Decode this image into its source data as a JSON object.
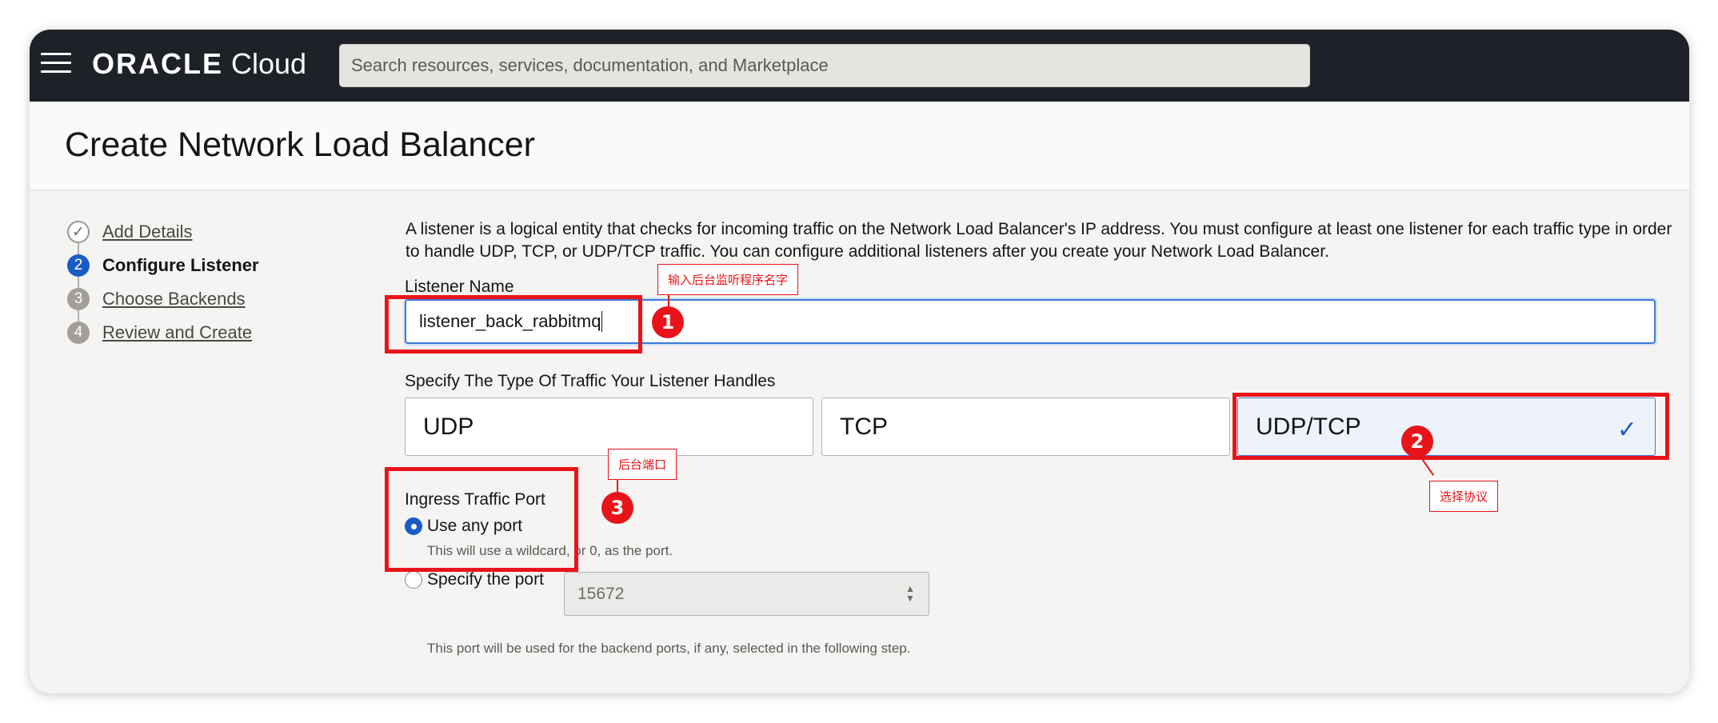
{
  "topbar": {
    "brand_oracle": "ORACLE",
    "brand_cloud": "Cloud",
    "search_placeholder": "Search resources, services, documentation, and Marketplace"
  },
  "page": {
    "title": "Create Network Load Balancer"
  },
  "steps": [
    {
      "number": "✓",
      "label": "Add Details",
      "state": "done"
    },
    {
      "number": "2",
      "label": "Configure Listener",
      "state": "active"
    },
    {
      "number": "3",
      "label": "Choose Backends",
      "state": "todo"
    },
    {
      "number": "4",
      "label": "Review and Create",
      "state": "todo"
    }
  ],
  "intro": "A listener is a logical entity that checks for incoming traffic on the Network Load Balancer's IP address. You must configure at least one listener for each traffic type in order to handle UDP, TCP, or UDP/TCP traffic. You can configure additional listeners after you create your Network Load Balancer.",
  "listener_name": {
    "label": "Listener Name",
    "value": "listener_back_rabbitmq"
  },
  "traffic": {
    "label": "Specify The Type Of Traffic Your Listener Handles",
    "options": [
      "UDP",
      "TCP",
      "UDP/TCP"
    ],
    "selected": "UDP/TCP"
  },
  "ingress": {
    "label": "Ingress Traffic Port",
    "any_port_label": "Use any port",
    "any_port_hint": "This will use a wildcard, or 0, as the port.",
    "specify_label": "Specify the port",
    "port_value": "15672",
    "footer_hint": "This port will be used for the backend ports, if any, selected in the following step.",
    "selected": "any"
  },
  "annotations": {
    "one": {
      "badge": "1",
      "text": "输入后台监听程序名字"
    },
    "two": {
      "badge": "2",
      "text": "选择协议"
    },
    "three": {
      "badge": "3",
      "text": "后台端口"
    }
  },
  "colors": {
    "accent": "#1a5cc6",
    "annotation": "#e8141a",
    "topbar": "#1e2228"
  },
  "icons": [
    "hamburger-menu-icon",
    "check-icon",
    "spinner-arrows-icon"
  ]
}
